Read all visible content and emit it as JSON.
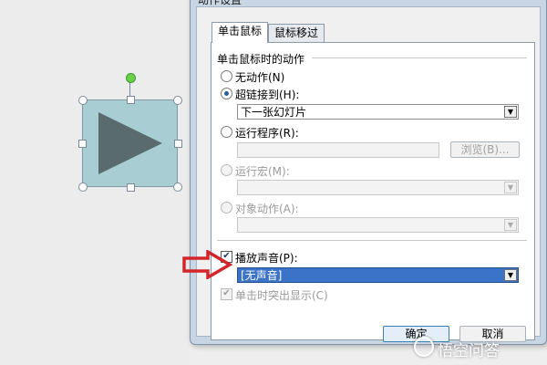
{
  "dialog": {
    "title": "动作设置",
    "tabs": [
      {
        "label": "单击鼠标",
        "selected": true
      },
      {
        "label": "鼠标移过",
        "selected": false
      }
    ],
    "group_title": "单击鼠标时的动作",
    "options": {
      "no_action": {
        "label": "无动作(N)",
        "checked": false
      },
      "hyperlink": {
        "label": "超链接到(H):",
        "checked": true,
        "value": "下一张幻灯片"
      },
      "run_program": {
        "label": "运行程序(R):",
        "checked": false,
        "value": ""
      },
      "browse_label": "浏览(B)...",
      "run_macro": {
        "label": "运行宏(M):",
        "checked": false,
        "value": ""
      },
      "object_action": {
        "label": "对象动作(A):",
        "checked": false,
        "value": ""
      }
    },
    "play_sound": {
      "label": "播放声音(P):",
      "checked": true,
      "value": "[无声音]"
    },
    "highlight_click": {
      "label": "单击时突出显示(C)",
      "checked": true
    },
    "ok_label": "确定",
    "cancel_label": "取消"
  },
  "slide": {
    "shape": "action-button-play",
    "shape_fill": "#a8cdd2",
    "shape_icon": "#5a6b6e"
  },
  "watermark": "悟空问答",
  "colors": {
    "accent_red": "#d2262b",
    "selection_blue": "#3b73c9"
  }
}
